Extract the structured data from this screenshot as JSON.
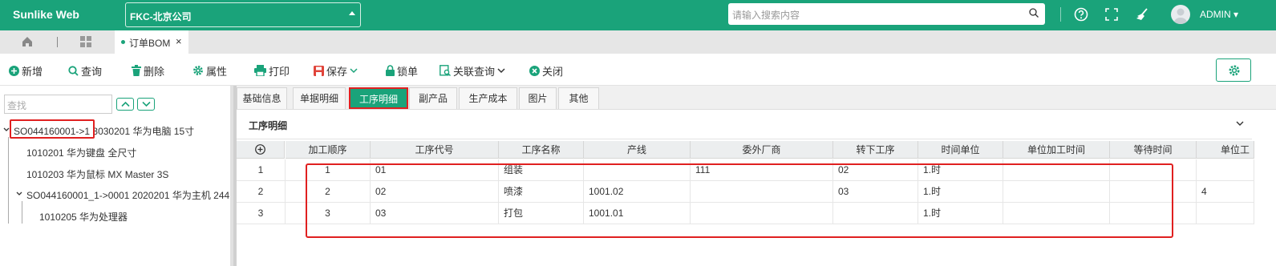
{
  "header": {
    "brand": "Sunlike Web",
    "company": "FKC-北京公司",
    "search_placeholder": "请输入搜索内容",
    "user": "ADMIN",
    "icons": [
      "help-icon",
      "fullscreen-icon",
      "broom-icon",
      "user-avatar-icon"
    ]
  },
  "tabs": {
    "home_icon": "home-icon",
    "grid_icon": "grid-icon",
    "active_tab": "订单BOM",
    "close": "×"
  },
  "toolbar": {
    "new": "新增",
    "query": "查询",
    "delete": "删除",
    "properties": "属性",
    "print": "打印",
    "save": "保存",
    "lock": "锁单",
    "related_query": "关联查询",
    "close": "关闭"
  },
  "tree": {
    "search_placeholder": "查找",
    "nodes": [
      {
        "label": "SO044160001->1 3030201 华为电脑 15寸",
        "level": 0,
        "expanded": true
      },
      {
        "label": "1010201 华为键盘 全尺寸",
        "level": 1
      },
      {
        "label": "1010203 华为鼠标 MX Master 3S",
        "level": 1
      },
      {
        "label": "SO044160001_1->0001 2020201 华为主机 244",
        "level": 1,
        "expanded": true
      },
      {
        "label": "1010205 华为处理器",
        "level": 2
      }
    ]
  },
  "detail_tabs": [
    "基础信息",
    "单据明细",
    "工序明细",
    "副产品",
    "生产成本",
    "图片",
    "其他"
  ],
  "active_detail_tab": "工序明细",
  "section": {
    "title": "工序明细"
  },
  "table": {
    "columns": [
      "加工顺序",
      "工序代号",
      "工序名称",
      "产线",
      "委外厂商",
      "转下工序",
      "时间单位",
      "单位加工时间",
      "等待时间",
      "单位工"
    ],
    "rows": [
      {
        "no": "1",
        "seq": "1",
        "code": "01",
        "name": "组装",
        "line": "",
        "vendor": "111",
        "next": "02",
        "unit": "1.时",
        "proc_time": "",
        "wait": "",
        "unit_w": ""
      },
      {
        "no": "2",
        "seq": "2",
        "code": "02",
        "name": "喷漆",
        "line": "1001.02",
        "vendor": "",
        "next": "03",
        "unit": "1.时",
        "proc_time": "",
        "wait": "",
        "unit_w": "4"
      },
      {
        "no": "3",
        "seq": "3",
        "code": "03",
        "name": "打包",
        "line": "1001.01",
        "vendor": "",
        "next": "",
        "unit": "1.时",
        "proc_time": "",
        "wait": "",
        "unit_w": ""
      }
    ]
  },
  "colors": {
    "primary": "#1aa37a",
    "highlight": "#e02020"
  }
}
